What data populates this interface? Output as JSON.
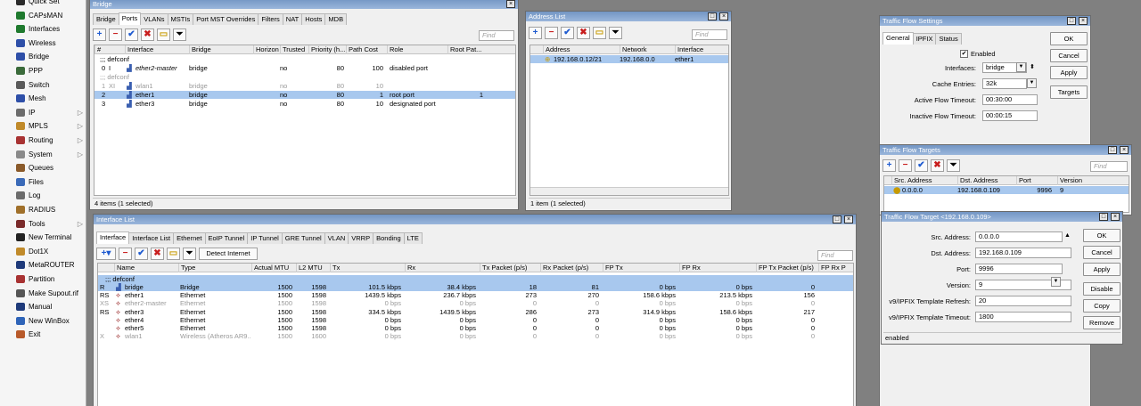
{
  "sidebar": {
    "items": [
      "Quick Set",
      "CAPsMAN",
      "Interfaces",
      "Wireless",
      "Bridge",
      "PPP",
      "Switch",
      "Mesh",
      "IP",
      "MPLS",
      "Routing",
      "System",
      "Queues",
      "Files",
      "Log",
      "RADIUS",
      "Tools",
      "New Terminal",
      "Dot1X",
      "MetaROUTER",
      "Partition",
      "Make Supout.rif",
      "Manual",
      "New WinBox",
      "Exit"
    ]
  },
  "bridge": {
    "title": "Bridge",
    "tabs": [
      "Bridge",
      "Ports",
      "VLANs",
      "MSTIs",
      "Port MST Overrides",
      "Filters",
      "NAT",
      "Hosts",
      "MDB"
    ],
    "active_tab": 1,
    "find": "Find",
    "columns": [
      "#",
      "Interface",
      "Bridge",
      "Horizon",
      "Trusted",
      "Priority (h...",
      "Path Cost",
      "Role",
      "Root Pat..."
    ],
    "group1": ";;; defconf",
    "group2": ";;; defconf",
    "rows": [
      [
        "0",
        "I",
        "ether2-master",
        "bridge",
        "",
        "no",
        "80",
        "100",
        "disabled port",
        ""
      ],
      [
        "1",
        "XI",
        "wlan1",
        "bridge",
        "",
        "no",
        "80",
        "10",
        "",
        ""
      ],
      [
        "2",
        "",
        "ether1",
        "bridge",
        "",
        "no",
        "80",
        "1",
        "root port",
        "1"
      ],
      [
        "3",
        "",
        "ether3",
        "bridge",
        "",
        "no",
        "80",
        "10",
        "designated port",
        ""
      ]
    ],
    "status": "4 items (1 selected)"
  },
  "address": {
    "title": "Address List",
    "find": "Find",
    "columns": [
      "Address",
      "Network",
      "Interface"
    ],
    "rows": [
      [
        "192.168.0.12/21",
        "192.168.0.0",
        "ether1"
      ]
    ],
    "status": "1 item (1 selected)"
  },
  "iflist": {
    "title": "Interface List",
    "tabs": [
      "Interface",
      "Interface List",
      "Ethernet",
      "EoIP Tunnel",
      "IP Tunnel",
      "GRE Tunnel",
      "VLAN",
      "VRRP",
      "Bonding",
      "LTE"
    ],
    "detect": "Detect Internet",
    "find": "Find",
    "columns": [
      "Name",
      "Type",
      "Actual MTU",
      "L2 MTU",
      "Tx",
      "Rx",
      "Tx Packet (p/s)",
      "Rx Packet (p/s)",
      "FP Tx",
      "FP Rx",
      "FP Tx Packet (p/s)",
      "FP Rx P"
    ],
    "group": ";;; defconf",
    "rows": [
      [
        "R",
        "bridge",
        "Bridge",
        "1500",
        "1598",
        "101.5 kbps",
        "38.4 kbps",
        "18",
        "81",
        "0 bps",
        "0 bps",
        "0"
      ],
      [
        "RS",
        "ether1",
        "Ethernet",
        "1500",
        "1598",
        "1439.5 kbps",
        "236.7 kbps",
        "273",
        "270",
        "158.6 kbps",
        "213.5 kbps",
        "156"
      ],
      [
        "XS",
        "ether2-master",
        "Ethernet",
        "1500",
        "1598",
        "0 bps",
        "0 bps",
        "0",
        "0",
        "0 bps",
        "0 bps",
        "0"
      ],
      [
        "RS",
        "ether3",
        "Ethernet",
        "1500",
        "1598",
        "334.5 kbps",
        "1439.5 kbps",
        "286",
        "273",
        "314.9 kbps",
        "158.6 kbps",
        "217"
      ],
      [
        "",
        "ether4",
        "Ethernet",
        "1500",
        "1598",
        "0 bps",
        "0 bps",
        "0",
        "0",
        "0 bps",
        "0 bps",
        "0"
      ],
      [
        "",
        "ether5",
        "Ethernet",
        "1500",
        "1598",
        "0 bps",
        "0 bps",
        "0",
        "0",
        "0 bps",
        "0 bps",
        "0"
      ],
      [
        "X",
        "wlan1",
        "Wireless (Atheros AR9...",
        "1500",
        "1600",
        "0 bps",
        "0 bps",
        "0",
        "0",
        "0 bps",
        "0 bps",
        "0"
      ]
    ]
  },
  "tfs": {
    "title": "Traffic Flow Settings",
    "tabs": [
      "General",
      "IPFIX",
      "Status"
    ],
    "enabled_label": "Enabled",
    "enabled": true,
    "labels": [
      "Interfaces:",
      "Cache Entries:",
      "Active Flow Timeout:",
      "Inactive Flow Timeout:"
    ],
    "values": [
      "bridge",
      "32k",
      "00:30:00",
      "00:00:15"
    ],
    "buttons": [
      "OK",
      "Cancel",
      "Apply",
      "Targets"
    ]
  },
  "tft": {
    "title": "Traffic Flow Targets",
    "find": "Find",
    "columns": [
      "Src. Address",
      "Dst. Address",
      "Port",
      "Version"
    ],
    "rows": [
      [
        "0.0.0.0",
        "192.168.0.109",
        "9996",
        "9"
      ]
    ]
  },
  "target": {
    "title": "Traffic Flow Target <192.168.0.109>",
    "labels": [
      "Src. Address:",
      "Dst. Address:",
      "Port:",
      "Version:",
      "v9/IPFIX Template Refresh:",
      "v9/IPFIX Template Timeout:"
    ],
    "values": [
      "0.0.0.0",
      "192.168.0.109",
      "9996",
      "9",
      "20",
      "1800"
    ],
    "buttons": [
      "OK",
      "Cancel",
      "Apply",
      "Disable",
      "Copy",
      "Remove"
    ],
    "status": "enabled"
  }
}
